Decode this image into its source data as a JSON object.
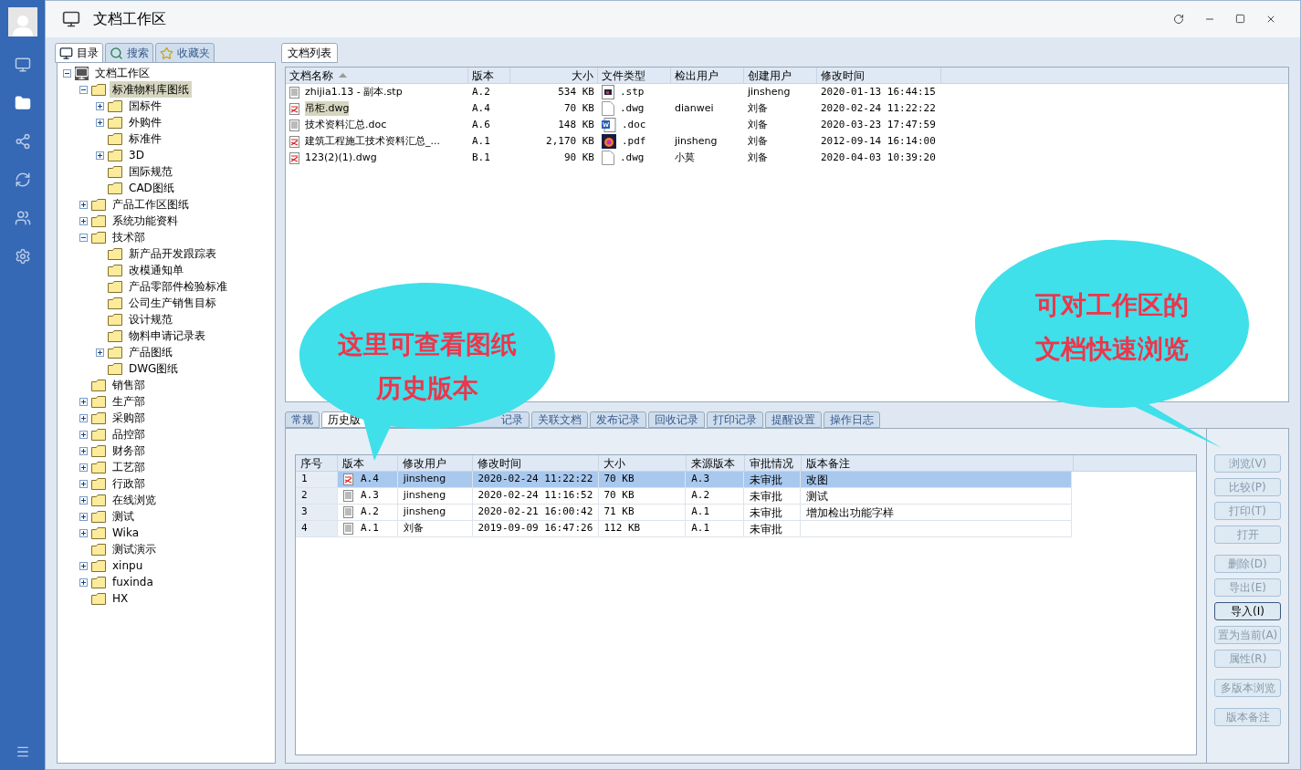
{
  "window": {
    "title": "文档工作区"
  },
  "left_tabs": [
    {
      "label": "目录",
      "selected": true
    },
    {
      "label": "搜索",
      "selected": false
    },
    {
      "label": "收藏夹",
      "selected": false
    }
  ],
  "tree": [
    {
      "label": "文档工作区",
      "kind": "expanded",
      "selected": false,
      "children": [
        {
          "label": "标准物料库图纸",
          "kind": "expanded",
          "selected": true,
          "children": [
            {
              "label": "国标件",
              "kind": "collapsed",
              "selected": false
            },
            {
              "label": "外购件",
              "kind": "collapsed",
              "selected": false
            },
            {
              "label": "标准件",
              "kind": "leaf",
              "selected": false
            },
            {
              "label": "3D",
              "kind": "collapsed",
              "selected": false
            },
            {
              "label": "国际规范",
              "kind": "leaf",
              "selected": false
            },
            {
              "label": "CAD图纸",
              "kind": "leaf",
              "selected": false
            }
          ]
        },
        {
          "label": "产品工作区图纸",
          "kind": "collapsed",
          "selected": false
        },
        {
          "label": "系统功能资料",
          "kind": "collapsed",
          "selected": false
        },
        {
          "label": "技术部",
          "kind": "expanded",
          "selected": false,
          "children": [
            {
              "label": "新产品开发跟踪表",
              "kind": "leaf",
              "selected": false
            },
            {
              "label": "改模通知单",
              "kind": "leaf",
              "selected": false
            },
            {
              "label": "产品零部件检验标准",
              "kind": "leaf",
              "selected": false
            },
            {
              "label": "公司生产销售目标",
              "kind": "leaf",
              "selected": false
            },
            {
              "label": "设计规范",
              "kind": "leaf",
              "selected": false
            },
            {
              "label": "物料申请记录表",
              "kind": "leaf",
              "selected": false
            },
            {
              "label": "产品图纸",
              "kind": "collapsed",
              "selected": false
            },
            {
              "label": "DWG图纸",
              "kind": "leaf",
              "selected": false
            }
          ]
        },
        {
          "label": "销售部",
          "kind": "leaf",
          "selected": false
        },
        {
          "label": "生产部",
          "kind": "collapsed",
          "selected": false
        },
        {
          "label": "采购部",
          "kind": "collapsed",
          "selected": false
        },
        {
          "label": "品控部",
          "kind": "collapsed",
          "selected": false
        },
        {
          "label": "财务部",
          "kind": "collapsed",
          "selected": false
        },
        {
          "label": "工艺部",
          "kind": "collapsed",
          "selected": false
        },
        {
          "label": "行政部",
          "kind": "collapsed",
          "selected": false
        },
        {
          "label": "在线浏览",
          "kind": "collapsed",
          "selected": false
        },
        {
          "label": "测试",
          "kind": "collapsed",
          "selected": false
        },
        {
          "label": "Wika",
          "kind": "collapsed",
          "selected": false
        },
        {
          "label": "测试演示",
          "kind": "leaf",
          "selected": false
        },
        {
          "label": "xinpu",
          "kind": "collapsed",
          "selected": false
        },
        {
          "label": "fuxinda",
          "kind": "collapsed",
          "selected": false
        },
        {
          "label": "HX",
          "kind": "leaf",
          "selected": false
        }
      ]
    }
  ],
  "doc_tab": {
    "label": "文档列表",
    "selected": true
  },
  "doc_table": {
    "columns": [
      "文档名称",
      "版本",
      "大小",
      "文件类型",
      "检出用户",
      "创建用户",
      "修改时间"
    ],
    "rows": [
      {
        "kind": "text",
        "name": "zhijia1.13 - 副本.stp",
        "version": "A.2",
        "size": "534 KB",
        "type": ".stp",
        "checkout_user": "",
        "creator": "jinsheng",
        "modified": "2020-01-13 16:44:15",
        "selected": false
      },
      {
        "kind": "drawing",
        "name": "吊柜.dwg",
        "version": "A.4",
        "size": "70 KB",
        "type": ".dwg",
        "checkout_user": "dianwei",
        "creator": "刘备",
        "modified": "2020-02-24 11:22:22",
        "selected": true
      },
      {
        "kind": "text",
        "name": "技术资料汇总.doc",
        "version": "A.6",
        "size": "148 KB",
        "type": ".doc",
        "checkout_user": "",
        "creator": "刘备",
        "modified": "2020-03-23 17:47:59",
        "selected": false
      },
      {
        "kind": "drawing",
        "name": "建筑工程施工技术资料汇总_...",
        "version": "A.1",
        "size": "2,170 KB",
        "type": ".pdf",
        "checkout_user": "jinsheng",
        "creator": "刘备",
        "modified": "2012-09-14 16:14:00",
        "selected": false
      },
      {
        "kind": "drawing",
        "name": "123(2)(1).dwg",
        "version": "B.1",
        "size": "90 KB",
        "type": ".dwg",
        "checkout_user": "小莫",
        "creator": "刘备",
        "modified": "2020-04-03 10:39:20",
        "selected": false
      }
    ]
  },
  "detail_tabs": [
    {
      "label": "常规",
      "selected": false
    },
    {
      "label": "历史版",
      "selected": true
    },
    {
      "label": "记录",
      "selected": false
    },
    {
      "label": "关联文档",
      "selected": false
    },
    {
      "label": "发布记录",
      "selected": false
    },
    {
      "label": "回收记录",
      "selected": false
    },
    {
      "label": "打印记录",
      "selected": false
    },
    {
      "label": "提醒设置",
      "selected": false
    },
    {
      "label": "操作日志",
      "selected": false
    }
  ],
  "history_table": {
    "columns": [
      "序号",
      "版本",
      "修改用户",
      "修改时间",
      "大小",
      "来源版本",
      "审批情况",
      "版本备注"
    ],
    "rows": [
      {
        "no": "1",
        "kind": "drawing",
        "version": "A.4",
        "user": "jinsheng",
        "modified": "2020-02-24 11:22:22",
        "size": "70 KB",
        "source": "A.3",
        "approval": "未审批",
        "note": "改图",
        "selected": true
      },
      {
        "no": "2",
        "kind": "text",
        "version": "A.3",
        "user": "jinsheng",
        "modified": "2020-02-24 11:16:52",
        "size": "70 KB",
        "source": "A.2",
        "approval": "未审批",
        "note": "测试",
        "selected": false
      },
      {
        "no": "3",
        "kind": "text",
        "version": "A.2",
        "user": "jinsheng",
        "modified": "2020-02-21 16:00:42",
        "size": "71 KB",
        "source": "A.1",
        "approval": "未审批",
        "note": "增加检出功能字样",
        "selected": false
      },
      {
        "no": "4",
        "kind": "text",
        "version": "A.1",
        "user": "刘备",
        "modified": "2019-09-09 16:47:26",
        "size": "112 KB",
        "source": "A.1",
        "approval": "未审批",
        "note": "",
        "selected": false
      }
    ]
  },
  "actions": [
    {
      "label": "浏览(V)",
      "disabled": true,
      "focused": false
    },
    {
      "label": "比较(P)",
      "disabled": true,
      "focused": false
    },
    {
      "label": "打印(T)",
      "disabled": true,
      "focused": false
    },
    {
      "label": "打开",
      "disabled": true,
      "focused": false
    },
    {
      "label": "删除(D)",
      "disabled": true,
      "focused": false
    },
    {
      "label": "导出(E)",
      "disabled": true,
      "focused": false
    },
    {
      "label": "导入(I)",
      "disabled": false,
      "focused": true
    },
    {
      "label": "置为当前(A)",
      "disabled": true,
      "focused": false
    },
    {
      "label": "属性(R)",
      "disabled": true,
      "focused": false
    },
    {
      "label": "多版本浏览",
      "disabled": true,
      "focused": false
    },
    {
      "label": "版本备注",
      "disabled": true,
      "focused": false
    }
  ],
  "callouts": [
    {
      "lines": [
        "这里可查看图纸",
        "历史版本"
      ]
    },
    {
      "lines": [
        "可对工作区的",
        "文档快速浏览"
      ]
    }
  ]
}
